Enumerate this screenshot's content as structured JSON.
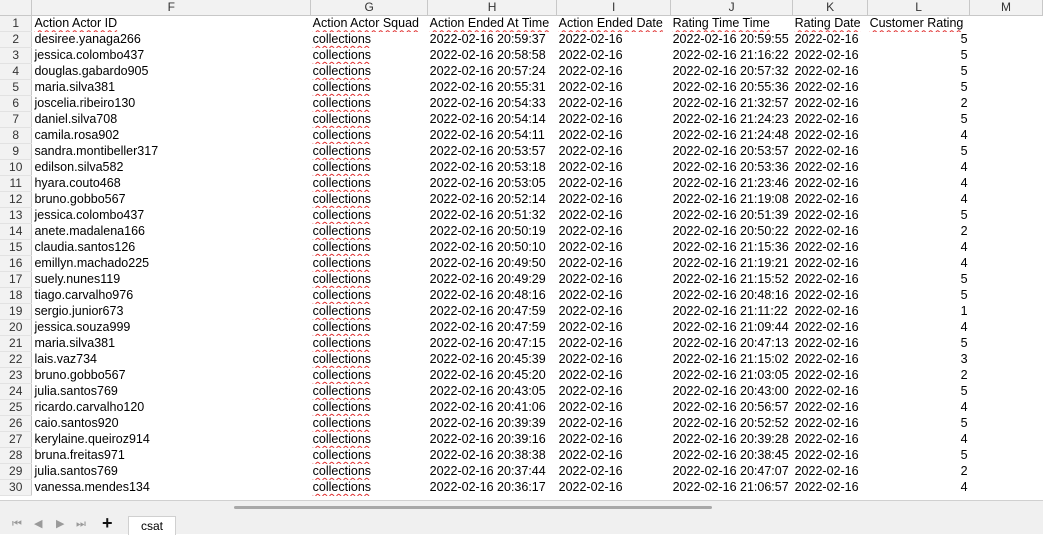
{
  "columns": [
    "F",
    "G",
    "H",
    "I",
    "J",
    "K",
    "L",
    "M"
  ],
  "header_row": {
    "num": "1",
    "cells": [
      "Action Actor ID",
      "Action Actor Squad",
      "Action Ended At Time",
      "Action Ended Date",
      "Rating Time Time",
      "Rating Date",
      "Customer Rating",
      ""
    ]
  },
  "rows": [
    {
      "num": "2",
      "actor": "desiree.yanaga266",
      "squad": "collections",
      "ended_time": "2022-02-16 20:59:37",
      "ended_date": "2022-02-16",
      "rating_time": "2022-02-16 20:59:55",
      "rating_date": "2022-02-16",
      "rating": "5"
    },
    {
      "num": "3",
      "actor": "jessica.colombo437",
      "squad": "collections",
      "ended_time": "2022-02-16 20:58:58",
      "ended_date": "2022-02-16",
      "rating_time": "2022-02-16 21:16:22",
      "rating_date": "2022-02-16",
      "rating": "5"
    },
    {
      "num": "4",
      "actor": "douglas.gabardo905",
      "squad": "collections",
      "ended_time": "2022-02-16 20:57:24",
      "ended_date": "2022-02-16",
      "rating_time": "2022-02-16 20:57:32",
      "rating_date": "2022-02-16",
      "rating": "5"
    },
    {
      "num": "5",
      "actor": "maria.silva381",
      "squad": "collections",
      "ended_time": "2022-02-16 20:55:31",
      "ended_date": "2022-02-16",
      "rating_time": "2022-02-16 20:55:36",
      "rating_date": "2022-02-16",
      "rating": "5"
    },
    {
      "num": "6",
      "actor": "joscelia.ribeiro130",
      "squad": "collections",
      "ended_time": "2022-02-16 20:54:33",
      "ended_date": "2022-02-16",
      "rating_time": "2022-02-16 21:32:57",
      "rating_date": "2022-02-16",
      "rating": "2"
    },
    {
      "num": "7",
      "actor": "daniel.silva708",
      "squad": "collections",
      "ended_time": "2022-02-16 20:54:14",
      "ended_date": "2022-02-16",
      "rating_time": "2022-02-16 21:24:23",
      "rating_date": "2022-02-16",
      "rating": "5"
    },
    {
      "num": "8",
      "actor": "camila.rosa902",
      "squad": "collections",
      "ended_time": "2022-02-16 20:54:11",
      "ended_date": "2022-02-16",
      "rating_time": "2022-02-16 21:24:48",
      "rating_date": "2022-02-16",
      "rating": "4"
    },
    {
      "num": "9",
      "actor": "sandra.montibeller317",
      "squad": "collections",
      "ended_time": "2022-02-16 20:53:57",
      "ended_date": "2022-02-16",
      "rating_time": "2022-02-16 20:53:57",
      "rating_date": "2022-02-16",
      "rating": "5"
    },
    {
      "num": "10",
      "actor": "edilson.silva582",
      "squad": "collections",
      "ended_time": "2022-02-16 20:53:18",
      "ended_date": "2022-02-16",
      "rating_time": "2022-02-16 20:53:36",
      "rating_date": "2022-02-16",
      "rating": "4"
    },
    {
      "num": "11",
      "actor": "hyara.couto468",
      "squad": "collections",
      "ended_time": "2022-02-16 20:53:05",
      "ended_date": "2022-02-16",
      "rating_time": "2022-02-16 21:23:46",
      "rating_date": "2022-02-16",
      "rating": "4"
    },
    {
      "num": "12",
      "actor": "bruno.gobbo567",
      "squad": "collections",
      "ended_time": "2022-02-16 20:52:14",
      "ended_date": "2022-02-16",
      "rating_time": "2022-02-16 21:19:08",
      "rating_date": "2022-02-16",
      "rating": "4"
    },
    {
      "num": "13",
      "actor": "jessica.colombo437",
      "squad": "collections",
      "ended_time": "2022-02-16 20:51:32",
      "ended_date": "2022-02-16",
      "rating_time": "2022-02-16 20:51:39",
      "rating_date": "2022-02-16",
      "rating": "5"
    },
    {
      "num": "14",
      "actor": "anete.madalena166",
      "squad": "collections",
      "ended_time": "2022-02-16 20:50:19",
      "ended_date": "2022-02-16",
      "rating_time": "2022-02-16 20:50:22",
      "rating_date": "2022-02-16",
      "rating": "2"
    },
    {
      "num": "15",
      "actor": "claudia.santos126",
      "squad": "collections",
      "ended_time": "2022-02-16 20:50:10",
      "ended_date": "2022-02-16",
      "rating_time": "2022-02-16 21:15:36",
      "rating_date": "2022-02-16",
      "rating": "4"
    },
    {
      "num": "16",
      "actor": "emillyn.machado225",
      "squad": "collections",
      "ended_time": "2022-02-16 20:49:50",
      "ended_date": "2022-02-16",
      "rating_time": "2022-02-16 21:19:21",
      "rating_date": "2022-02-16",
      "rating": "4"
    },
    {
      "num": "17",
      "actor": "suely.nunes119",
      "squad": "collections",
      "ended_time": "2022-02-16 20:49:29",
      "ended_date": "2022-02-16",
      "rating_time": "2022-02-16 21:15:52",
      "rating_date": "2022-02-16",
      "rating": "5"
    },
    {
      "num": "18",
      "actor": "tiago.carvalho976",
      "squad": "collections",
      "ended_time": "2022-02-16 20:48:16",
      "ended_date": "2022-02-16",
      "rating_time": "2022-02-16 20:48:16",
      "rating_date": "2022-02-16",
      "rating": "5"
    },
    {
      "num": "19",
      "actor": "sergio.junior673",
      "squad": "collections",
      "ended_time": "2022-02-16 20:47:59",
      "ended_date": "2022-02-16",
      "rating_time": "2022-02-16 21:11:22",
      "rating_date": "2022-02-16",
      "rating": "1"
    },
    {
      "num": "20",
      "actor": "jessica.souza999",
      "squad": "collections",
      "ended_time": "2022-02-16 20:47:59",
      "ended_date": "2022-02-16",
      "rating_time": "2022-02-16 21:09:44",
      "rating_date": "2022-02-16",
      "rating": "4"
    },
    {
      "num": "21",
      "actor": "maria.silva381",
      "squad": "collections",
      "ended_time": "2022-02-16 20:47:15",
      "ended_date": "2022-02-16",
      "rating_time": "2022-02-16 20:47:13",
      "rating_date": "2022-02-16",
      "rating": "5"
    },
    {
      "num": "22",
      "actor": "lais.vaz734",
      "squad": "collections",
      "ended_time": "2022-02-16 20:45:39",
      "ended_date": "2022-02-16",
      "rating_time": "2022-02-16 21:15:02",
      "rating_date": "2022-02-16",
      "rating": "3"
    },
    {
      "num": "23",
      "actor": "bruno.gobbo567",
      "squad": "collections",
      "ended_time": "2022-02-16 20:45:20",
      "ended_date": "2022-02-16",
      "rating_time": "2022-02-16 21:03:05",
      "rating_date": "2022-02-16",
      "rating": "2"
    },
    {
      "num": "24",
      "actor": "julia.santos769",
      "squad": "collections",
      "ended_time": "2022-02-16 20:43:05",
      "ended_date": "2022-02-16",
      "rating_time": "2022-02-16 20:43:00",
      "rating_date": "2022-02-16",
      "rating": "5"
    },
    {
      "num": "25",
      "actor": "ricardo.carvalho120",
      "squad": "collections",
      "ended_time": "2022-02-16 20:41:06",
      "ended_date": "2022-02-16",
      "rating_time": "2022-02-16 20:56:57",
      "rating_date": "2022-02-16",
      "rating": "4"
    },
    {
      "num": "26",
      "actor": "caio.santos920",
      "squad": "collections",
      "ended_time": "2022-02-16 20:39:39",
      "ended_date": "2022-02-16",
      "rating_time": "2022-02-16 20:52:52",
      "rating_date": "2022-02-16",
      "rating": "5"
    },
    {
      "num": "27",
      "actor": "kerylaine.queiroz914",
      "squad": "collections",
      "ended_time": "2022-02-16 20:39:16",
      "ended_date": "2022-02-16",
      "rating_time": "2022-02-16 20:39:28",
      "rating_date": "2022-02-16",
      "rating": "4"
    },
    {
      "num": "28",
      "actor": "bruna.freitas971",
      "squad": "collections",
      "ended_time": "2022-02-16 20:38:38",
      "ended_date": "2022-02-16",
      "rating_time": "2022-02-16 20:38:45",
      "rating_date": "2022-02-16",
      "rating": "5"
    },
    {
      "num": "29",
      "actor": "julia.santos769",
      "squad": "collections",
      "ended_time": "2022-02-16 20:37:44",
      "ended_date": "2022-02-16",
      "rating_time": "2022-02-16 20:47:07",
      "rating_date": "2022-02-16",
      "rating": "2"
    },
    {
      "num": "30",
      "actor": "vanessa.mendes134",
      "squad": "collections",
      "ended_time": "2022-02-16 20:36:17",
      "ended_date": "2022-02-16",
      "rating_time": "2022-02-16 21:06:57",
      "rating_date": "2022-02-16",
      "rating": "4"
    }
  ],
  "tabs": {
    "add_icon": "plus-icon",
    "add_glyph": "+",
    "sheet_name": "csat"
  },
  "nav": {
    "first_glyph": "⏮",
    "prev_glyph": "◀",
    "next_glyph": "▶",
    "last_glyph": "⏭"
  }
}
